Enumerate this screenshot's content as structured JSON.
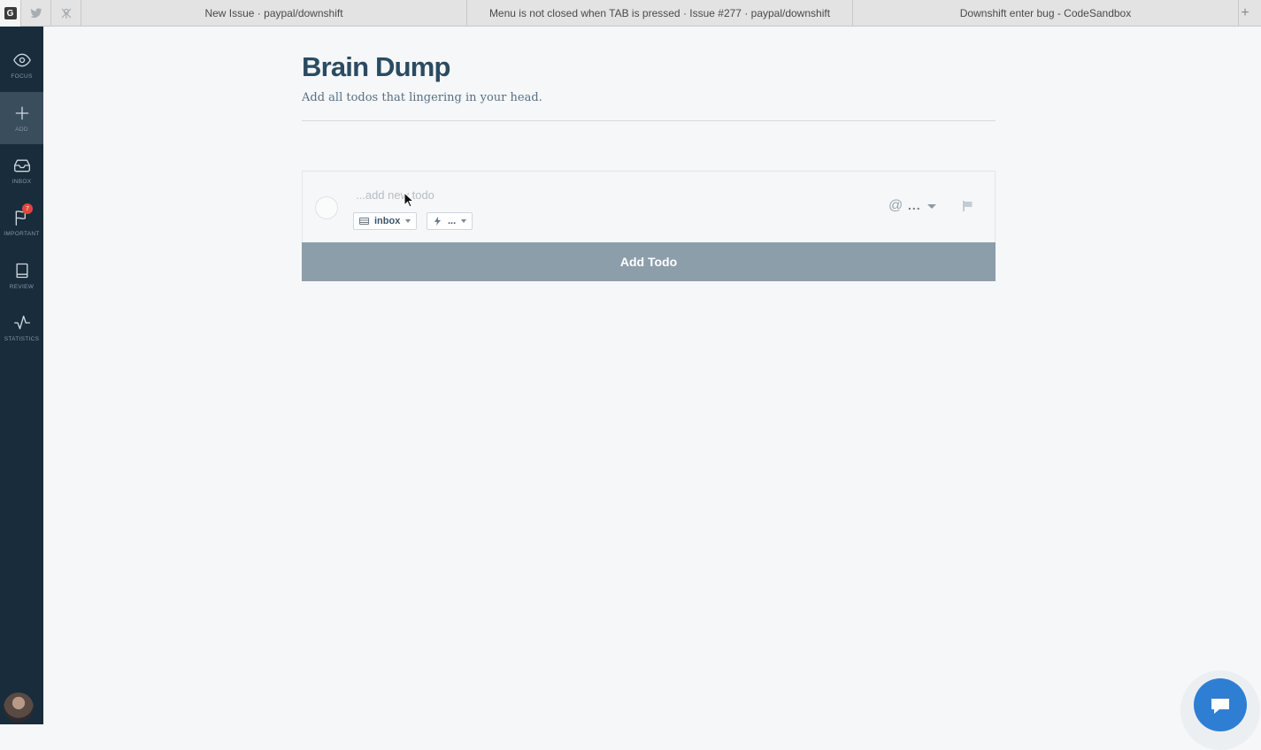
{
  "browser": {
    "pinned_tabs": [
      {
        "icon": "g-app-icon",
        "label": "G"
      },
      {
        "icon": "twitter-icon"
      },
      {
        "icon": "app-icon"
      }
    ],
    "tabs": [
      "New Issue · paypal/downshift",
      "Menu is not closed when TAB is pressed · Issue #277 · paypal/downshift",
      "Downshift enter bug - CodeSandbox"
    ],
    "new_tab": "+"
  },
  "sidebar": {
    "items": [
      {
        "label": "FOCUS",
        "icon": "eye-icon"
      },
      {
        "label": "ADD",
        "icon": "plus-icon",
        "active": true
      },
      {
        "label": "INBOX",
        "icon": "inbox-icon"
      },
      {
        "label": "IMPORTANT",
        "icon": "flag-icon",
        "badge": "7"
      },
      {
        "label": "REVIEW",
        "icon": "book-icon"
      },
      {
        "label": "STATISTICS",
        "icon": "activity-icon"
      }
    ]
  },
  "page": {
    "title": "Brain Dump",
    "subtitle": "Add all todos that lingering in your head."
  },
  "todo": {
    "placeholder": "...add new todo",
    "value": "",
    "list_chip": "inbox",
    "energy_chip": "...",
    "assignee_symbol": "@",
    "assignee_value": "..."
  },
  "add_button": "Add Todo",
  "colors": {
    "sidebar_bg": "#182c3b",
    "title": "#2a4b62",
    "button_bg": "#8d9eab",
    "chat_button": "#2e7fd3",
    "badge": "#e0473b"
  }
}
